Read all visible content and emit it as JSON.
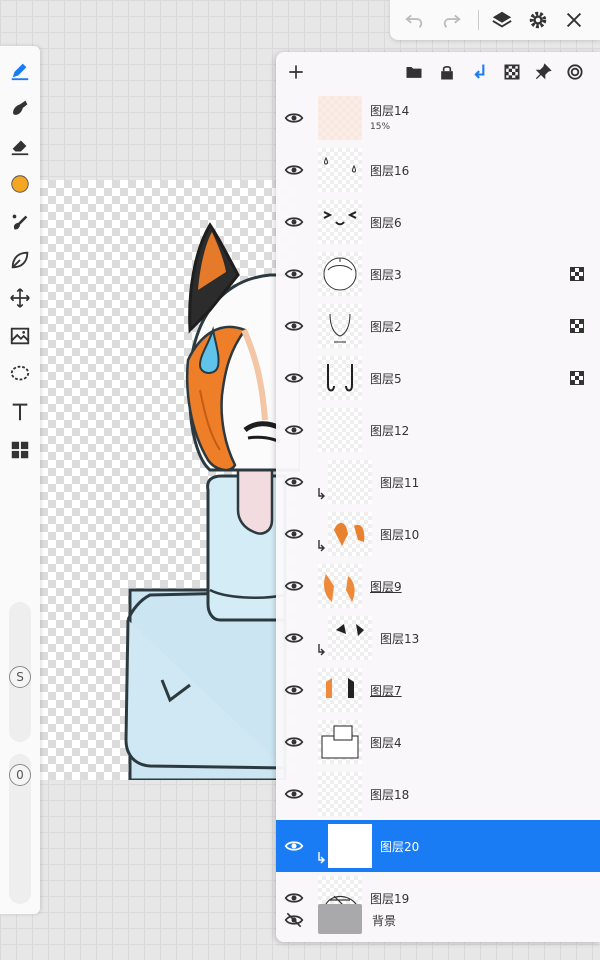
{
  "app": {
    "accent": "#1a7cf5",
    "brush_color": "#f5a623"
  },
  "toolbar": {
    "tools": [
      {
        "name": "brush-tool",
        "icon": "pen-icon",
        "active": true
      },
      {
        "name": "smudge-tool",
        "icon": "smudge-icon"
      },
      {
        "name": "eraser-tool",
        "icon": "eraser-icon"
      },
      {
        "name": "color-picker",
        "icon": "color-swatch-icon"
      },
      {
        "name": "fill-tool",
        "icon": "fill-brush-icon"
      },
      {
        "name": "blur-tool",
        "icon": "leaf-icon"
      },
      {
        "name": "move-tool",
        "icon": "move-arrows-icon"
      },
      {
        "name": "image-adjust-tool",
        "icon": "image-icon"
      },
      {
        "name": "lasso-tool",
        "icon": "lasso-icon"
      },
      {
        "name": "text-tool",
        "icon": "text-icon"
      },
      {
        "name": "panels-tool",
        "icon": "grid-icon"
      }
    ],
    "size_label": "S",
    "opacity_label": "0"
  },
  "topbar": {
    "buttons": [
      {
        "name": "undo-button",
        "icon": "undo-icon",
        "enabled": false
      },
      {
        "name": "redo-button",
        "icon": "redo-icon",
        "enabled": false
      },
      {
        "name": "layers-button",
        "icon": "layers-icon",
        "enabled": true
      },
      {
        "name": "settings-button",
        "icon": "gear-icon",
        "enabled": true
      },
      {
        "name": "close-button",
        "icon": "close-icon",
        "enabled": true
      }
    ]
  },
  "layers_panel": {
    "header_buttons": [
      {
        "name": "add-layer-button",
        "icon": "plus-icon"
      },
      {
        "name": "folder-button",
        "icon": "folder-icon"
      },
      {
        "name": "lock-button",
        "icon": "lock-icon"
      },
      {
        "name": "clip-button",
        "icon": "clip-arrow-icon",
        "active": true
      },
      {
        "name": "alpha-lock-button",
        "icon": "checker-icon"
      },
      {
        "name": "pin-button",
        "icon": "pin-icon"
      },
      {
        "name": "ref-button",
        "icon": "target-icon"
      }
    ],
    "layers": [
      {
        "name": "图层14",
        "opacity": "15%",
        "clipped": false,
        "alpha_lock": false,
        "underline": false,
        "selected": false,
        "thumb": "skin"
      },
      {
        "name": "图层16",
        "clipped": false,
        "alpha_lock": false,
        "underline": false,
        "selected": false,
        "thumb": "drops"
      },
      {
        "name": "图层6",
        "clipped": false,
        "alpha_lock": false,
        "underline": false,
        "selected": false,
        "thumb": "face"
      },
      {
        "name": "图层3",
        "clipped": false,
        "alpha_lock": true,
        "underline": false,
        "selected": false,
        "thumb": "head"
      },
      {
        "name": "图层2",
        "clipped": false,
        "alpha_lock": true,
        "underline": false,
        "selected": false,
        "thumb": "body"
      },
      {
        "name": "图层5",
        "clipped": false,
        "alpha_lock": true,
        "underline": false,
        "selected": false,
        "thumb": "arms"
      },
      {
        "name": "图层12",
        "clipped": false,
        "alpha_lock": false,
        "underline": false,
        "selected": false,
        "thumb": "blank"
      },
      {
        "name": "图层11",
        "clipped": true,
        "alpha_lock": false,
        "underline": false,
        "selected": false,
        "thumb": "blank"
      },
      {
        "name": "图层10",
        "clipped": true,
        "alpha_lock": false,
        "underline": false,
        "selected": false,
        "thumb": "hair"
      },
      {
        "name": "图层9",
        "clipped": false,
        "alpha_lock": false,
        "underline": true,
        "selected": false,
        "thumb": "hair2"
      },
      {
        "name": "图层13",
        "clipped": true,
        "alpha_lock": false,
        "underline": false,
        "selected": false,
        "thumb": "ears"
      },
      {
        "name": "图层7",
        "clipped": false,
        "alpha_lock": false,
        "underline": true,
        "selected": false,
        "thumb": "ears2"
      },
      {
        "name": "图层4",
        "clipped": false,
        "alpha_lock": false,
        "underline": false,
        "selected": false,
        "thumb": "blocks"
      },
      {
        "name": "图层18",
        "clipped": false,
        "alpha_lock": false,
        "underline": false,
        "selected": false,
        "thumb": "blank"
      },
      {
        "name": "图层20",
        "clipped": true,
        "alpha_lock": false,
        "underline": false,
        "selected": true,
        "thumb": "white"
      },
      {
        "name": "图层19",
        "clipped": false,
        "alpha_lock": false,
        "underline": false,
        "selected": false,
        "thumb": "sketch"
      }
    ],
    "background_label": "背景",
    "background_color": "#a9a9ab"
  }
}
